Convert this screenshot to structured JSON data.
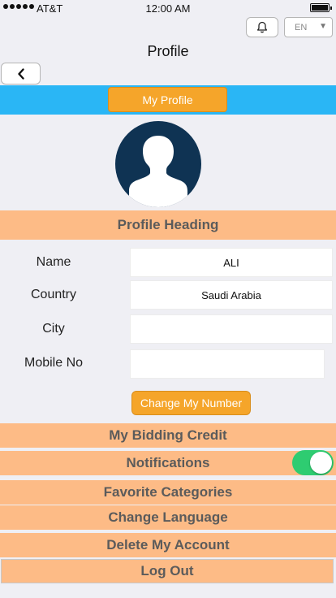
{
  "status_bar": {
    "carrier": "AT&T",
    "time": "12:00 AM"
  },
  "header": {
    "title": "Profile",
    "language": "EN",
    "icons": {
      "bell": "bell-icon",
      "back": "chevron-left-icon",
      "dropdown": "caret-down-icon"
    }
  },
  "profile_tab": {
    "label": "My Profile"
  },
  "avatar": {
    "icon": "user-silhouette-icon"
  },
  "section": {
    "heading": "Profile Heading"
  },
  "fields": [
    {
      "label": "Name",
      "value": "ALI"
    },
    {
      "label": "Country",
      "value": "Saudi Arabia"
    },
    {
      "label": "City",
      "value": ""
    },
    {
      "label": "Mobile No",
      "value": ""
    }
  ],
  "change_number_label": "Change My Number",
  "menu": {
    "bidding_credit": "My Bidding Credit",
    "notifications": "Notifications",
    "notifications_enabled": true,
    "favorite_categories": "Favorite Categories",
    "change_language": "Change Language",
    "delete_account": "Delete My Account",
    "log_out": "Log Out"
  },
  "colors": {
    "accent_orange": "#f5a52a",
    "header_blue": "#2ab6f5",
    "section_bg": "#fdbb86",
    "toggle_on": "#2ecc71",
    "avatar_bg": "#0f3353"
  }
}
